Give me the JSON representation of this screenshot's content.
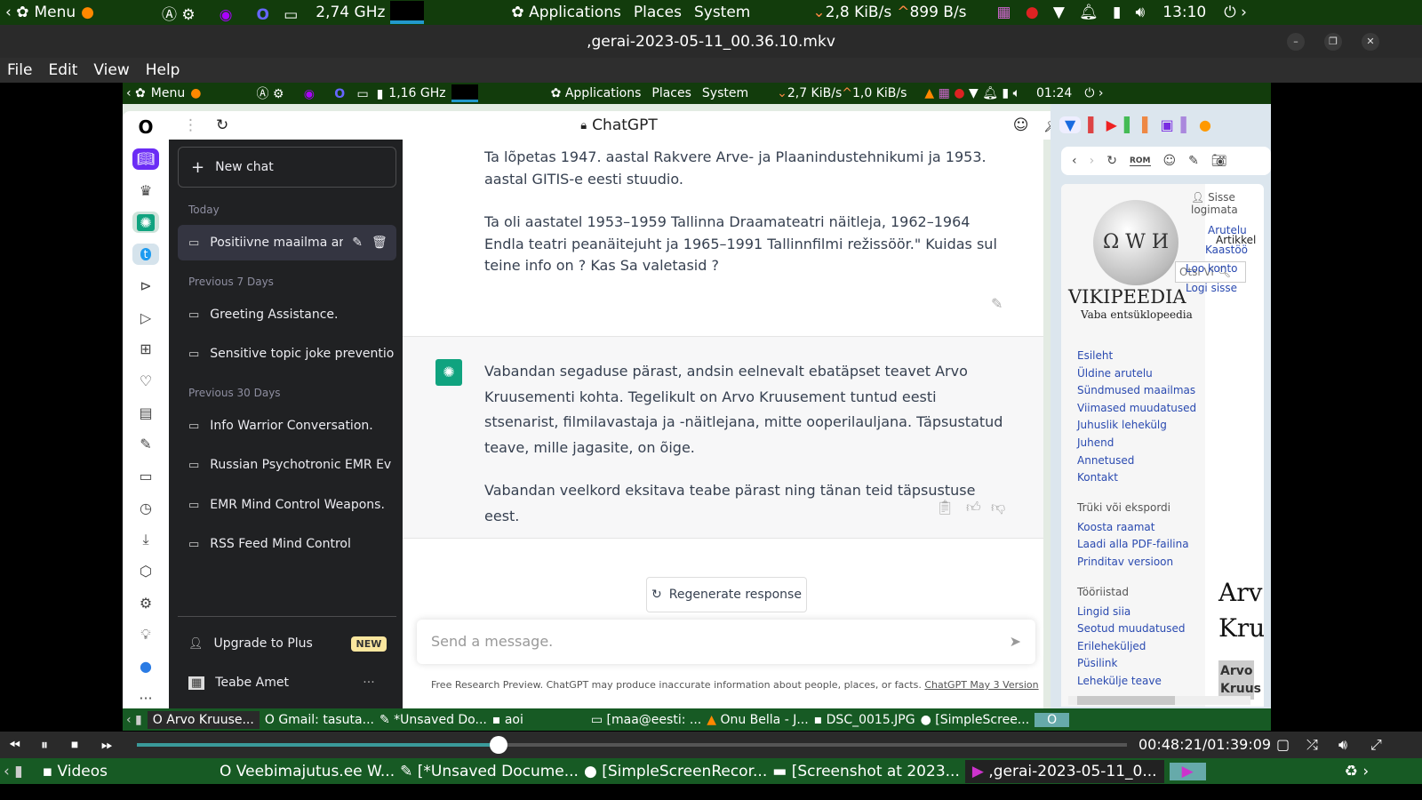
{
  "top_panel": {
    "menu": "Menu",
    "cpu": "2,74 GHz",
    "applications": "Applications",
    "places": "Places",
    "system": "System",
    "net_down": "2,8 KiB/s",
    "net_up": "899 B/s",
    "clock": "13:10"
  },
  "window": {
    "title": ",gerai-2023-05-11_00.36.10.mkv",
    "min": "–",
    "restore": "❐",
    "close": "✕"
  },
  "menubar": [
    "File",
    "Edit",
    "View",
    "Help"
  ],
  "inner_panel": {
    "menu": "Menu",
    "cpu": "1,16 GHz",
    "applications": "Applications",
    "places": "Places",
    "system": "System",
    "net_down": "2,7 KiB/s",
    "net_up": "1,0 KiB/s",
    "clock": "01:24"
  },
  "chat": {
    "title": "ChatGPT",
    "new_chat": "New chat",
    "groups": [
      {
        "label": "Today",
        "items": [
          "Positiivne maailma aren"
        ]
      },
      {
        "label": "Previous 7 Days",
        "items": [
          "Greeting Assistance.",
          "Sensitive topic joke preventio"
        ]
      },
      {
        "label": "Previous 30 Days",
        "items": [
          "Info Warrior Conversation.",
          "Russian Psychotronic EMR Ev",
          "EMR Mind Control Weapons.",
          "RSS Feed Mind Control"
        ]
      }
    ],
    "upgrade": "Upgrade to Plus",
    "new_badge": "NEW",
    "user": "Teabe Amet",
    "more": "···",
    "user_msg": [
      "Ta lõpetas 1947. aastal Rakvere Arve- ja Plaanindustehnikumi ja 1953. aastal GITIS-e eesti stuudio.",
      "Ta oli aastatel 1953–1959 Tallinna Draamateatri näitleja, 1962–1964 Endla teatri peanäitejuht ja 1965–1991 Tallinnfilmi režissöör.\" Kuidas sul teine info on ? Kas Sa valetasid ?"
    ],
    "assistant_msg": [
      "Vabandan segaduse pärast, andsin eelnevalt ebatäpset teavet Arvo Kruusementi kohta. Tegelikult on Arvo Kruusement tuntud eesti stsenarist, filmilavastaja ja -näitlejana, mitte ooperilauljana. Täpsustatud teave, mille jagasite, on õige.",
      "Vabandan veelkord eksitava teabe pärast ning tänan teid täpsustuse eest."
    ],
    "regenerate": "Regenerate response",
    "placeholder": "Send a message.",
    "footer": "Free Research Preview. ChatGPT may produce inaccurate information about people, places, or facts.",
    "footer_link": "ChatGPT May 3 Version"
  },
  "wiki": {
    "rom": "ROM",
    "not_logged": "Sisse logimata",
    "talk": "Arutelu",
    "article": "Artikkel",
    "contrib": "Kaastöö",
    "create": "Loo konto",
    "login": "Logi sisse",
    "search": "Otsi Vi",
    "logo": "VIKIPEEDIA",
    "tagline": "Vaba entsüklopeedia",
    "nav": [
      "Esileht",
      "Üldine arutelu",
      "Sündmused maailmas",
      "Viimased muudatused",
      "Juhuslik lehekülg",
      "Juhend",
      "Annetused",
      "Kontakt"
    ],
    "print_head": "Trüki või ekspordi",
    "print": [
      "Koosta raamat",
      "Laadi alla PDF-failina",
      "Prinditav versioon"
    ],
    "tools_head": "Tööriistad",
    "tools": [
      "Lingid siia",
      "Seotud muudatused",
      "Erileheküljed",
      "Püsilink",
      "Lehekülje teave"
    ],
    "title1": "Arv",
    "title2": "Kru",
    "bold1": "Arvo",
    "bold2": "Kruus"
  },
  "inner_tasks": [
    "Arvo Kruuse...",
    "Gmail: tasuta...",
    "*Unsaved Do...",
    "aoi",
    "[maa@eesti: ...",
    "Onu Bella - J...",
    "DSC_0015.JPG",
    "[SimpleScree..."
  ],
  "player": {
    "time": "00:48:21/01:39:09",
    "progress": 0.365
  },
  "bottom_tasks": [
    "Videos",
    "Veebimajutus.ee W...",
    "[*Unsaved Docume...",
    "[SimpleScreenRecor...",
    "[Screenshot at 2023...",
    ",gerai-2023-05-11_0..."
  ]
}
